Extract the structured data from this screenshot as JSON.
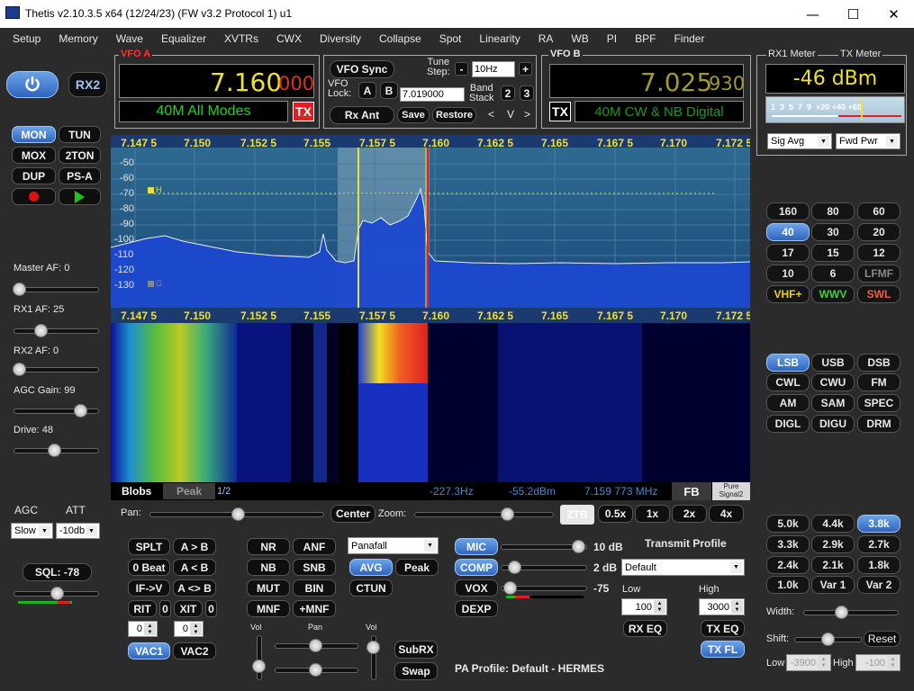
{
  "titlebar": {
    "title": "Thetis v2.10.3.5 x64 (12/24/23) (FW v3.2 Protocol 1) u1",
    "minimize": "—",
    "maximize": "☐",
    "close": "✕"
  },
  "menu": [
    "Setup",
    "Memory",
    "Wave",
    "Equalizer",
    "XVTRs",
    "CWX",
    "Diversity",
    "Collapse",
    "Spot",
    "Linearity",
    "RA",
    "WB",
    "PI",
    "BPF",
    "Finder"
  ],
  "left": {
    "rx2": "RX2",
    "mon": "MON",
    "tun": "TUN",
    "mox": "MOX",
    "twoton": "2TON",
    "dup": "DUP",
    "psa": "PS-A",
    "master_af": "Master AF:  0",
    "rx1_af": "RX1 AF:  25",
    "rx2_af": "RX2 AF:  0",
    "agc_gain": "AGC Gain:  99",
    "drive": "Drive:  48",
    "agc_label": "AGC",
    "att_label": "ATT",
    "agc_value": "Slow",
    "att_value": "-10db",
    "sql": "SQL:  -78"
  },
  "vfoa": {
    "title": "VFO A",
    "freq_main": "7.160",
    "freq_sub": "000",
    "mode": "40M All Modes",
    "tx": "TX"
  },
  "center": {
    "vfo_sync": "VFO Sync",
    "vfo_lock": "VFO\nLock:",
    "a": "A",
    "b": "B",
    "lock_freq": "7.019000",
    "tune_step_label": "Tune\nStep:",
    "tune_step": "10Hz",
    "minus": "-",
    "plus": "+",
    "band_stack": "Band\nStack",
    "bs2": "2",
    "bs3": "3",
    "prev": "<",
    "v": "V",
    "next": ">",
    "rx_ant": "Rx Ant",
    "save": "Save",
    "restore": "Restore"
  },
  "vfob": {
    "title": "VFO B",
    "freq_main": "7.025",
    "freq_sub": "930",
    "mode": "40M CW & NB Digital",
    "tx": "TX"
  },
  "meter": {
    "rx1": "RX1 Meter",
    "tx": "TX Meter",
    "value": "-46 dBm",
    "scale": "1  3  5  7  9  +20 +40 +60",
    "rx_mode": "Sig Avg",
    "tx_mode": "Fwd Pwr"
  },
  "display": {
    "ticks": [
      "7.147 5",
      "7.150",
      "7.152 5",
      "7.155",
      "7.157 5",
      "7.160",
      "7.162 5",
      "7.165",
      "7.167 5",
      "7.170",
      "7.172 5"
    ],
    "db": [
      "-50",
      "-60",
      "-70",
      "-80",
      "-90",
      "-100",
      "-110",
      "-120",
      "-130"
    ],
    "blobs": "Blobs",
    "peak": "Peak",
    "page": "1/2",
    "offset": "-227.3Hz",
    "level": "-55.2dBm",
    "cursor": "7.159 773 MHz",
    "fb": "FB",
    "pure_signal": "Pure\nSignal2"
  },
  "pan": {
    "pan": "Pan:",
    "center": "Center",
    "zoom": "Zoom:",
    "ztb": "ZTB",
    "z05": "0.5x",
    "z1": "1x",
    "z2": "2x",
    "z4": "4x"
  },
  "bands": [
    "160",
    "80",
    "60",
    "40",
    "30",
    "20",
    "17",
    "15",
    "12",
    "10",
    "6",
    "LFMF",
    "VHF+",
    "WWV",
    "SWL"
  ],
  "modes": [
    "LSB",
    "USB",
    "DSB",
    "CWL",
    "CWU",
    "FM",
    "AM",
    "SAM",
    "SPEC",
    "DIGL",
    "DIGU",
    "DRM"
  ],
  "filters": [
    "5.0k",
    "4.4k",
    "3.8k",
    "3.3k",
    "2.9k",
    "2.7k",
    "2.4k",
    "2.1k",
    "1.8k",
    "1.0k",
    "Var 1",
    "Var 2"
  ],
  "filter": {
    "width": "Width:",
    "shift": "Shift:",
    "reset": "Reset",
    "low": "Low",
    "high": "High",
    "low_val": "-3900",
    "high_val": "-100"
  },
  "split": {
    "splt": "SPLT",
    "atob": "A > B",
    "zerobeat": "0 Beat",
    "altb": "A < B",
    "ifv": "IF->V",
    "aswap": "A <> B",
    "rit": "RIT",
    "rit_v": "0",
    "xit": "XIT",
    "xit_v": "0",
    "rit_val": "0",
    "xit_val": "0",
    "vac1": "VAC1",
    "vac2": "VAC2"
  },
  "dsp": {
    "nr": "NR",
    "anf": "ANF",
    "nb": "NB",
    "snb": "SNB",
    "mut": "MUT",
    "bin": "BIN",
    "mnf": "MNF",
    "pmnf": "+MNF",
    "display_mode": "Panafall",
    "avg": "AVG",
    "peak": "Peak",
    "ctun": "CTUN"
  },
  "vol": {
    "vol1": "Vol",
    "pan": "Pan",
    "vol2": "Vol",
    "subrx": "SubRX",
    "swap": "Swap"
  },
  "tx": {
    "mic": "MIC",
    "mic_val": "10 dB",
    "comp": "COMP",
    "comp_val": "2 dB",
    "vox": "VOX",
    "vox_val": "-75",
    "dexp": "DEXP",
    "profile_label": "Transmit Profile",
    "profile": "Default",
    "low": "Low",
    "high": "High",
    "low_val": "100",
    "high_val": "3000",
    "rx_eq": "RX EQ",
    "tx_eq": "TX EQ",
    "tx_fl": "TX FL",
    "pa_profile": "PA Profile: Default - HERMES"
  },
  "colors": {
    "accent": "#4a86d8",
    "vfo_green": "#1fd41f",
    "tx_red": "#e02020",
    "freq_yellow": "#f0e030"
  }
}
